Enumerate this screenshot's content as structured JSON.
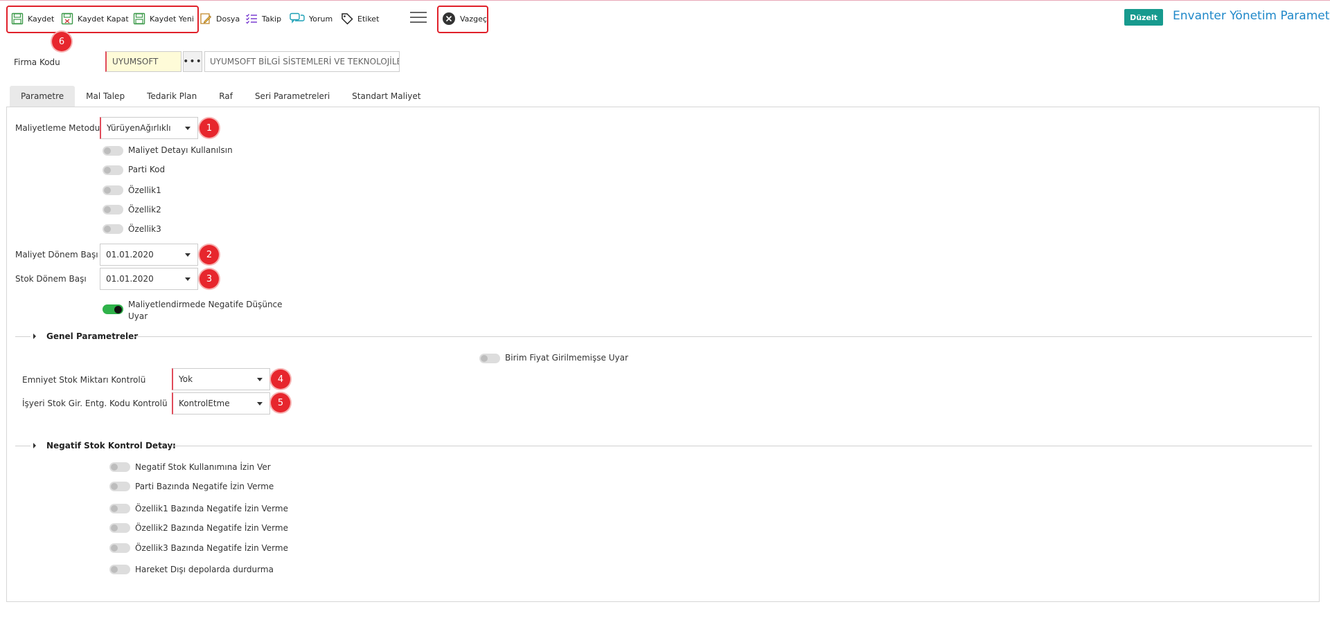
{
  "toolbar": {
    "kaydet": "Kaydet",
    "kaydet_kapat": "Kaydet Kapat",
    "kaydet_yeni": "Kaydet Yeni",
    "dosya": "Dosya",
    "takip": "Takip",
    "yorum": "Yorum",
    "etiket": "Etiket",
    "vazgec": "Vazgeç",
    "duzelt": "Düzelt",
    "title": "Envanter Yönetim Parametre"
  },
  "markers": {
    "m1": "1",
    "m2": "2",
    "m3": "3",
    "m4": "4",
    "m5": "5",
    "m6": "6"
  },
  "firma": {
    "label": "Firma Kodu",
    "code": "UYUMSOFT",
    "lookup": "•••",
    "name": "UYUMSOFT BİLGİ SİSTEMLERİ VE TEKNOLOJİLE"
  },
  "tabs": [
    "Parametre",
    "Mal Talep",
    "Tedarik Plan",
    "Raf",
    "Seri Parametreleri",
    "Standart Maliyet"
  ],
  "maliyet": {
    "metod_label": "Maliyetleme Metodu",
    "metod_value": "YürüyenAğırlıklı",
    "toggles": [
      "Maliyet Detayı Kullanılsın",
      "Parti Kod",
      "Özellik1",
      "Özellik2",
      "Özellik3"
    ],
    "donem_basi_label": "Maliyet Dönem Başı",
    "donem_basi_value": "01.01.2020",
    "stok_donem_label": "Stok Dönem Başı",
    "stok_donem_value": "01.01.2020",
    "negatif_uyar_line1": "Maliyetlendirmede Negatife Düşünce",
    "negatif_uyar_line2": "Uyar"
  },
  "genel": {
    "title": "Genel Parametreler",
    "birim_fiyat": "Birim Fiyat Girilmemişse Uyar",
    "emniyet_label": "Emniyet Stok Miktarı Kontrolü",
    "emniyet_value": "Yok",
    "isyeri_label": "İşyeri Stok Gir. Entg. Kodu Kontrolü",
    "isyeri_value": "KontrolEtme"
  },
  "negatif": {
    "title": "Negatif Stok Kontrol Detayı",
    "toggles": [
      "Negatif Stok Kullanımına İzin Ver",
      "Parti Bazında Negatife İzin Verme",
      "Özellik1 Bazında Negatife İzin Verme",
      "Özellik2 Bazında Negatife İzin Verme",
      "Özellik3 Bazında Negatife İzin Verme",
      "Hareket Dışı depolarda durdurma"
    ]
  },
  "colors": {
    "accent": "#1f88c9",
    "badge": "#179a8e",
    "marker": "#e7262d",
    "toggle_on": "#2fb24a"
  }
}
